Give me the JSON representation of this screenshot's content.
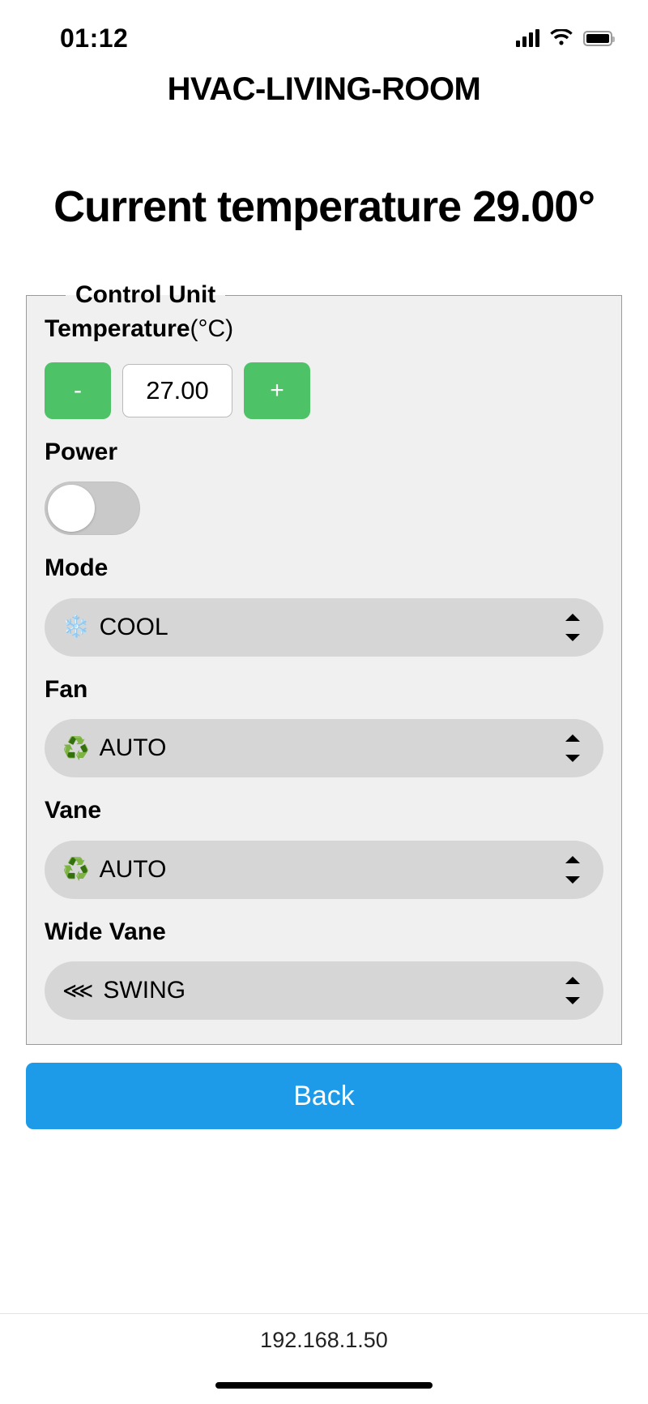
{
  "status_bar": {
    "time": "01:12",
    "signal_icon": "cellular-signal-icon",
    "wifi_icon": "wifi-icon",
    "battery_icon": "battery-full-icon"
  },
  "header": {
    "device_title": "HVAC-LIVING-ROOM"
  },
  "current_temperature": {
    "label": "Current temperature",
    "value": "29.00°"
  },
  "control_unit": {
    "legend": "Control Unit",
    "temperature": {
      "label": "Temperature",
      "unit": "(°C)",
      "decrement_label": "-",
      "increment_label": "+",
      "value": "27.00"
    },
    "power": {
      "label": "Power",
      "state": "off"
    },
    "mode": {
      "label": "Mode",
      "icon": "snowflake-icon",
      "icon_glyph": "❄️",
      "value": "COOL"
    },
    "fan": {
      "label": "Fan",
      "icon": "recycle-icon",
      "icon_glyph": "♻️",
      "value": "AUTO"
    },
    "vane": {
      "label": "Vane",
      "icon": "recycle-icon",
      "icon_glyph": "♻️",
      "value": "AUTO"
    },
    "wide_vane": {
      "label": "Wide Vane",
      "icon": "swing-arrows-icon",
      "icon_glyph": "⋘",
      "value": "SWING"
    }
  },
  "footer": {
    "back_label": "Back",
    "url": "192.168.1.50"
  },
  "colors": {
    "accent_green": "#4ec267",
    "accent_blue": "#1e9be8",
    "panel_bg": "#f0f0f0",
    "select_bg": "#d6d6d6",
    "toggle_off": "#c9c9c9"
  }
}
